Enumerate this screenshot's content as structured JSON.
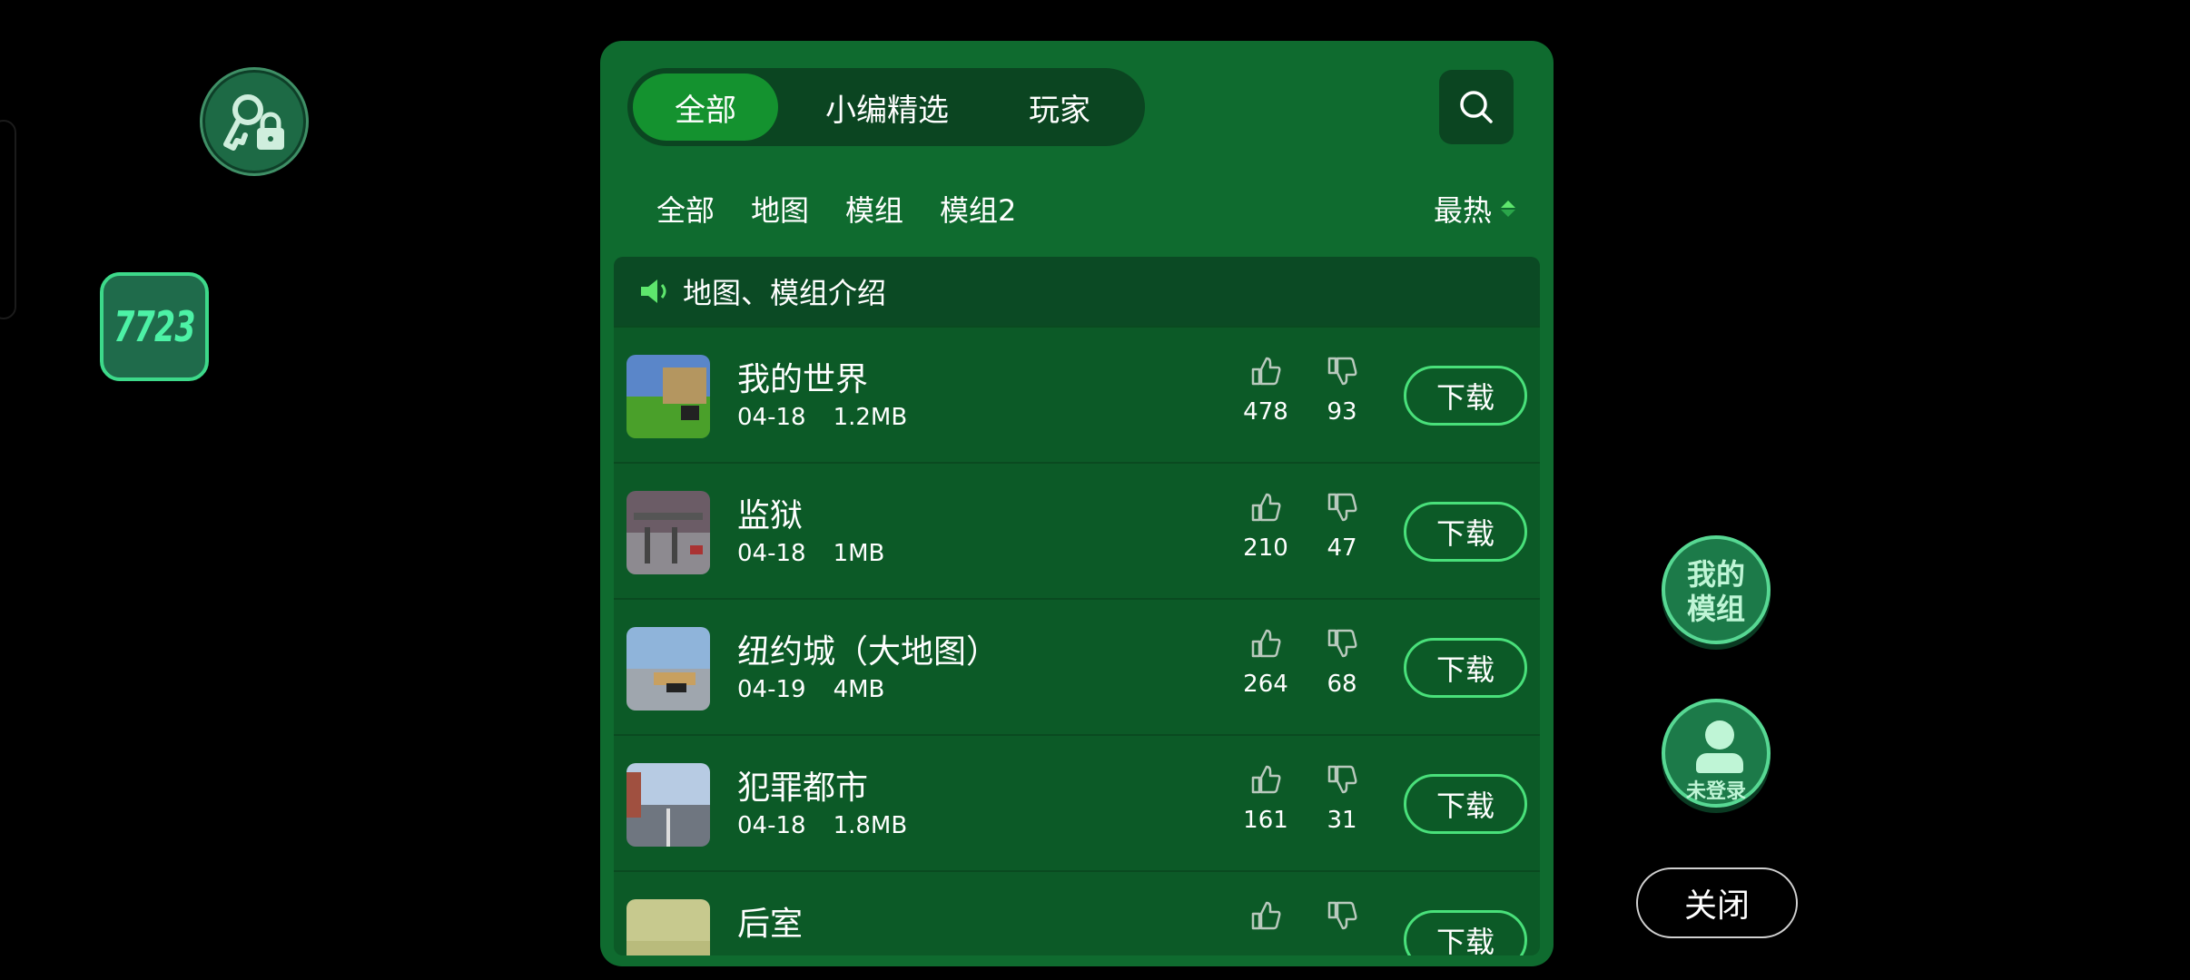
{
  "tabs": [
    {
      "label": "全部",
      "active": true
    },
    {
      "label": "小编精选",
      "active": false
    },
    {
      "label": "玩家",
      "active": false
    }
  ],
  "filters": [
    "全部",
    "地图",
    "模组",
    "模组2"
  ],
  "sort": {
    "label": "最热"
  },
  "notice": {
    "text": "地图、模组介绍"
  },
  "logo": {
    "text": "7723"
  },
  "items": [
    {
      "title": "我的世界",
      "date": "04-18",
      "size": "1.2MB",
      "likes": "478",
      "dislikes": "93",
      "action": "下载"
    },
    {
      "title": "监狱",
      "date": "04-18",
      "size": "1MB",
      "likes": "210",
      "dislikes": "47",
      "action": "下载"
    },
    {
      "title": "纽约城（大地图）",
      "date": "04-19",
      "size": "4MB",
      "likes": "264",
      "dislikes": "68",
      "action": "下载"
    },
    {
      "title": "犯罪都市",
      "date": "04-18",
      "size": "1.8MB",
      "likes": "161",
      "dislikes": "31",
      "action": "下载"
    },
    {
      "title": "后室",
      "date": "",
      "size": "",
      "likes": "",
      "dislikes": "",
      "action": "下载"
    }
  ],
  "side": {
    "my_mod_line1": "我的",
    "my_mod_line2": "模组",
    "login_label": "未登录",
    "close_label": "关闭"
  },
  "colors": {
    "panel": "#0f6b2f",
    "accent": "#49e07a",
    "active_tab": "#14922f"
  }
}
